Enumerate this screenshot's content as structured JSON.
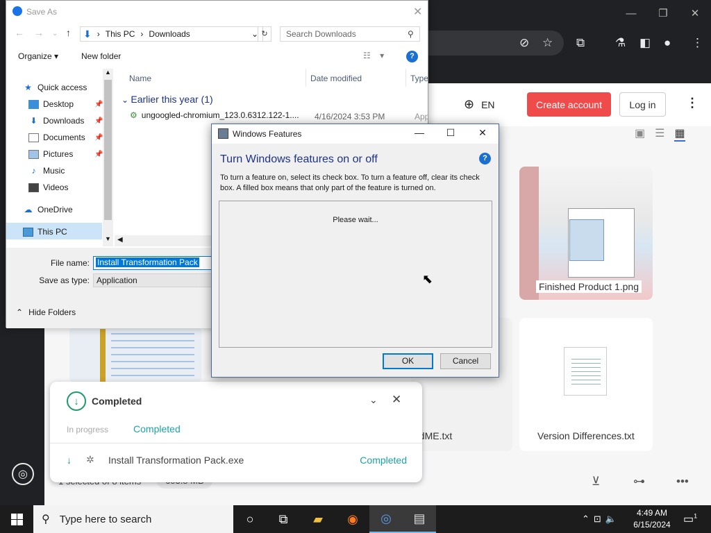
{
  "browser": {
    "controls": {
      "minimize": "—",
      "maximize": "❐",
      "close": "✕"
    },
    "omnibox_icons": [
      "eye-slash-icon",
      "star-icon",
      "puzzle-icon",
      "flask-icon",
      "sidepanel-icon",
      "profile-icon",
      "menu-icon"
    ]
  },
  "site": {
    "lang": "EN",
    "create_account": "Create account",
    "log_in": "Log in",
    "cards": [
      {
        "name": "Finished Product 1.png"
      },
      {
        "name": "adME.txt"
      },
      {
        "name": "Version Differences.txt"
      }
    ],
    "selection_info": "1 selected of 8 items",
    "selection_size": "603.8 MB"
  },
  "downloads": {
    "title": "Completed",
    "tabs": {
      "in_progress": "In progress",
      "completed": "Completed"
    },
    "item": {
      "name": "Install Transformation Pack.exe",
      "status": "Completed"
    }
  },
  "save_as": {
    "title": "Save As",
    "path": [
      "This PC",
      "Downloads"
    ],
    "search_placeholder": "Search Downloads",
    "organize": "Organize ▾",
    "new_folder": "New folder",
    "nav": {
      "quick_access": "Quick access",
      "desktop": "Desktop",
      "downloads": "Downloads",
      "documents": "Documents",
      "pictures": "Pictures",
      "music": "Music",
      "videos": "Videos",
      "onedrive": "OneDrive",
      "this_pc": "This PC"
    },
    "columns": {
      "name": "Name",
      "date_modified": "Date modified",
      "type": "Type"
    },
    "group": "Earlier this year (1)",
    "file": {
      "name": "ungoogled-chromium_123.0.6312.122-1....",
      "date": "4/16/2024 3:53 PM",
      "type": "Appli"
    },
    "file_name_label": "File name:",
    "file_name_value": "Install Transformation Pack",
    "save_type_label": "Save as type:",
    "save_type_value": "Application",
    "hide_folders": "Hide Folders"
  },
  "windows_features": {
    "title": "Windows Features",
    "heading": "Turn Windows features on or off",
    "description": "To turn a feature on, select its check box. To turn a feature off, clear its check box. A filled box means that only part of the feature is turned on.",
    "wait": "Please wait...",
    "ok": "OK",
    "cancel": "Cancel"
  },
  "taskbar": {
    "search_placeholder": "Type here to search",
    "time": "4:49 AM",
    "date": "6/15/2024",
    "notification_count": "1"
  }
}
